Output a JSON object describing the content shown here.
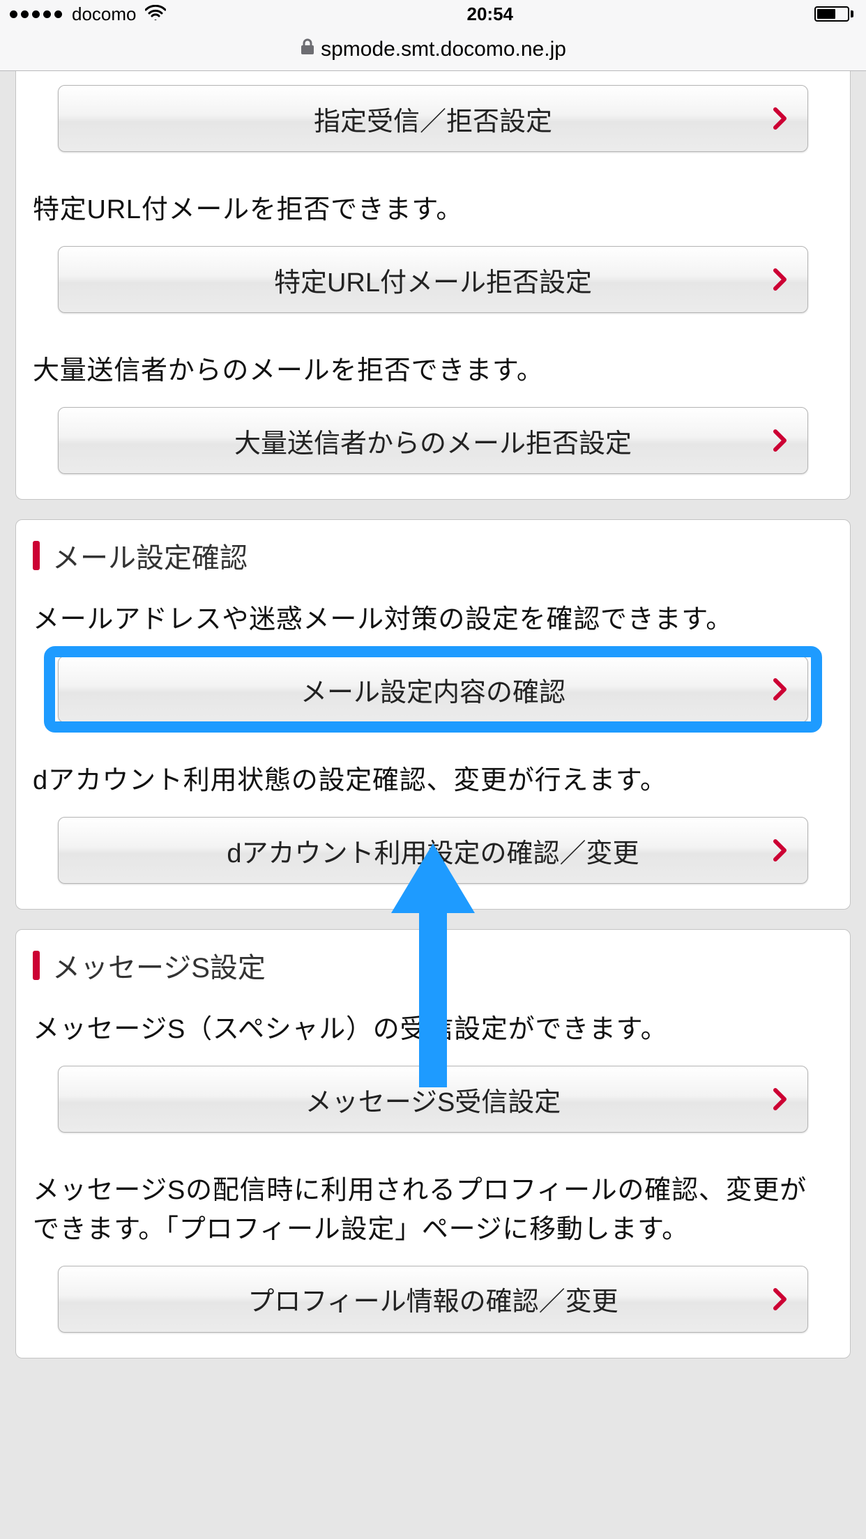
{
  "status": {
    "carrier": "docomo",
    "time": "20:54"
  },
  "address": {
    "url": "spmode.smt.docomo.ne.jp"
  },
  "colors": {
    "accent": "#cc0033",
    "highlight": "#1e9bff"
  },
  "panels": [
    {
      "id": "spam-settings",
      "header": null,
      "items": [
        {
          "desc": null,
          "button": "指定受信／拒否設定",
          "name": "designated-receive-reject-settings-button"
        },
        {
          "desc": "特定URL付メールを拒否できます。",
          "button": "特定URL付メール拒否設定",
          "name": "url-mail-reject-settings-button"
        },
        {
          "desc": "大量送信者からのメールを拒否できます。",
          "button": "大量送信者からのメール拒否設定",
          "name": "mass-sender-reject-settings-button"
        }
      ]
    },
    {
      "id": "mail-settings-confirm",
      "header": "メール設定確認",
      "items": [
        {
          "desc": "メールアドレスや迷惑メール対策の設定を確認できます。",
          "button": "メール設定内容の確認",
          "name": "mail-settings-confirm-button",
          "highlighted": true
        },
        {
          "desc": "dアカウント利用状態の設定確認、変更が行えます。",
          "button": "dアカウント利用設定の確認／変更",
          "name": "d-account-settings-button"
        }
      ]
    },
    {
      "id": "message-s-settings",
      "header": "メッセージS設定",
      "items": [
        {
          "desc": "メッセージS（スペシャル）の受信設定ができます。",
          "button": "メッセージS受信設定",
          "name": "message-s-receive-settings-button"
        },
        {
          "desc": "メッセージSの配信時に利用されるプロフィールの確認、変更ができます。「プロフィール設定」ページに移動します。",
          "button": "プロフィール情報の確認／変更",
          "name": "profile-info-settings-button"
        }
      ]
    }
  ]
}
